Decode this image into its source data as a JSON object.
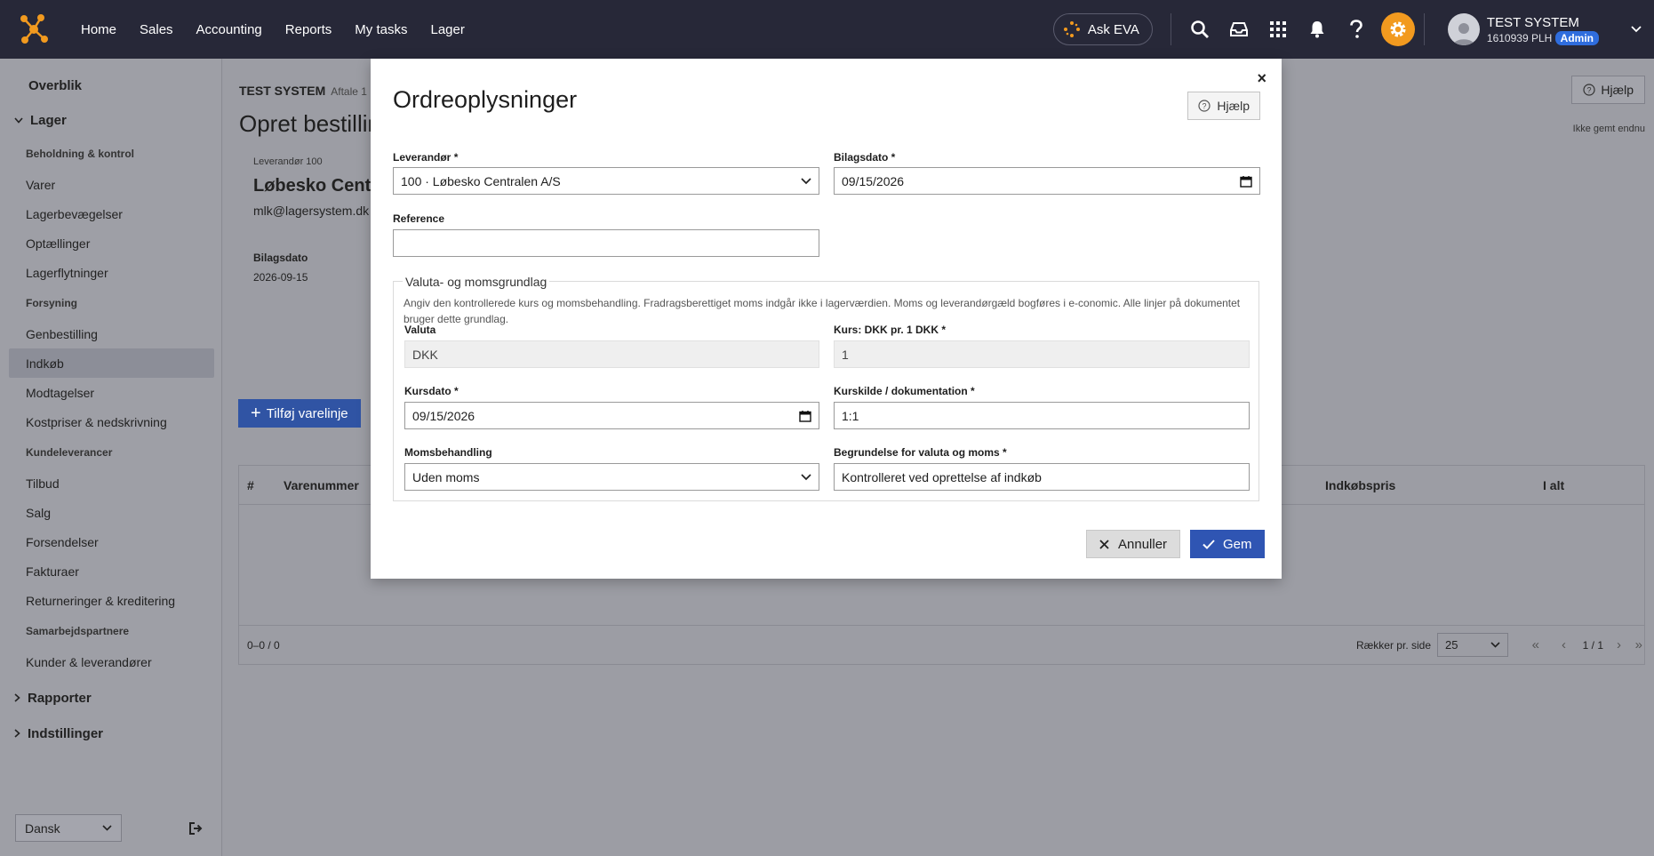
{
  "nav": {
    "items": [
      "Home",
      "Sales",
      "Accounting",
      "Reports",
      "My tasks",
      "Lager"
    ],
    "ask_eva": "Ask EVA",
    "user_name": "TEST SYSTEM",
    "user_sub": "1610939 PLH",
    "user_role": "Admin"
  },
  "sidebar": {
    "overview": "Overblik",
    "group_lager": "Lager",
    "sections": {
      "beholdning": "Beholdning & kontrol",
      "forsyning": "Forsyning",
      "kundeleverancer": "Kundeleverancer",
      "samarbejdspartnere": "Samarbejdspartnere"
    },
    "items": {
      "varer": "Varer",
      "lagerbevaegelser": "Lagerbevægelser",
      "optaellinger": "Optællinger",
      "lagerflytninger": "Lagerflytninger",
      "genbestilling": "Genbestilling",
      "indkoeb": "Indkøb",
      "modtagelser": "Modtagelser",
      "kostpriser": "Kostpriser & nedskrivning",
      "tilbud": "Tilbud",
      "salg": "Salg",
      "forsendelser": "Forsendelser",
      "fakturaer": "Fakturaer",
      "returneringer": "Returneringer & kreditering",
      "kunder": "Kunder & leverandører"
    },
    "group_rapporter": "Rapporter",
    "group_indstillinger": "Indstillinger",
    "language": "Dansk"
  },
  "page": {
    "breadcrumb": "TEST SYSTEM",
    "breadcrumb_sub": "Aftale 1",
    "title": "Opret bestilling",
    "help": "Hjælp",
    "not_saved": "Ikke gemt endnu",
    "supplier_label": "Leverandør 100",
    "supplier_name": "Løbesko Cent",
    "supplier_email": "mlk@lagersystem.dk",
    "bilagsdato_label": "Bilagsdato",
    "bilagsdato_value": "2026-09-15",
    "add_line": "Tilføj varelinje",
    "table": {
      "col_num": "#",
      "col_varenummer": "Varenummer",
      "col_indkobspris": "Indkøbspris",
      "col_ialt": "I alt",
      "range": "0–0 / 0",
      "rows_per_page_label": "Rækker pr. side",
      "rows_per_page": "25",
      "pages": "1 / 1"
    }
  },
  "modal": {
    "title": "Ordreoplysninger",
    "help": "Hjælp",
    "supplier_label": "Leverandør *",
    "supplier_value": "100 · Løbesko Centralen A/S",
    "date_label": "Bilagsdato *",
    "date_value": "09/15/2026",
    "reference_label": "Reference",
    "reference_value": "",
    "fieldset_legend": "Valuta- og momsgrundlag",
    "fieldset_desc": "Angiv den kontrollerede kurs og momsbehandling. Fradragsberettiget moms indgår ikke i lagerværdien. Moms og leverandørgæld bogføres i e-conomic. Alle linjer på dokumentet bruger dette grundlag.",
    "currency_label": "Valuta",
    "currency_value": "DKK",
    "rate_label": "Kurs: DKK pr. 1 DKK *",
    "rate_value": "1",
    "rate_date_label": "Kursdato *",
    "rate_date_value": "09/15/2026",
    "rate_source_label": "Kurskilde / dokumentation *",
    "rate_source_value": "1:1",
    "vat_label": "Momsbehandling",
    "vat_value": "Uden moms",
    "reason_label": "Begrundelse for valuta og moms *",
    "reason_value": "Kontrolleret ved oprettelse af indkøb",
    "cancel": "Annuller",
    "save": "Gem"
  }
}
